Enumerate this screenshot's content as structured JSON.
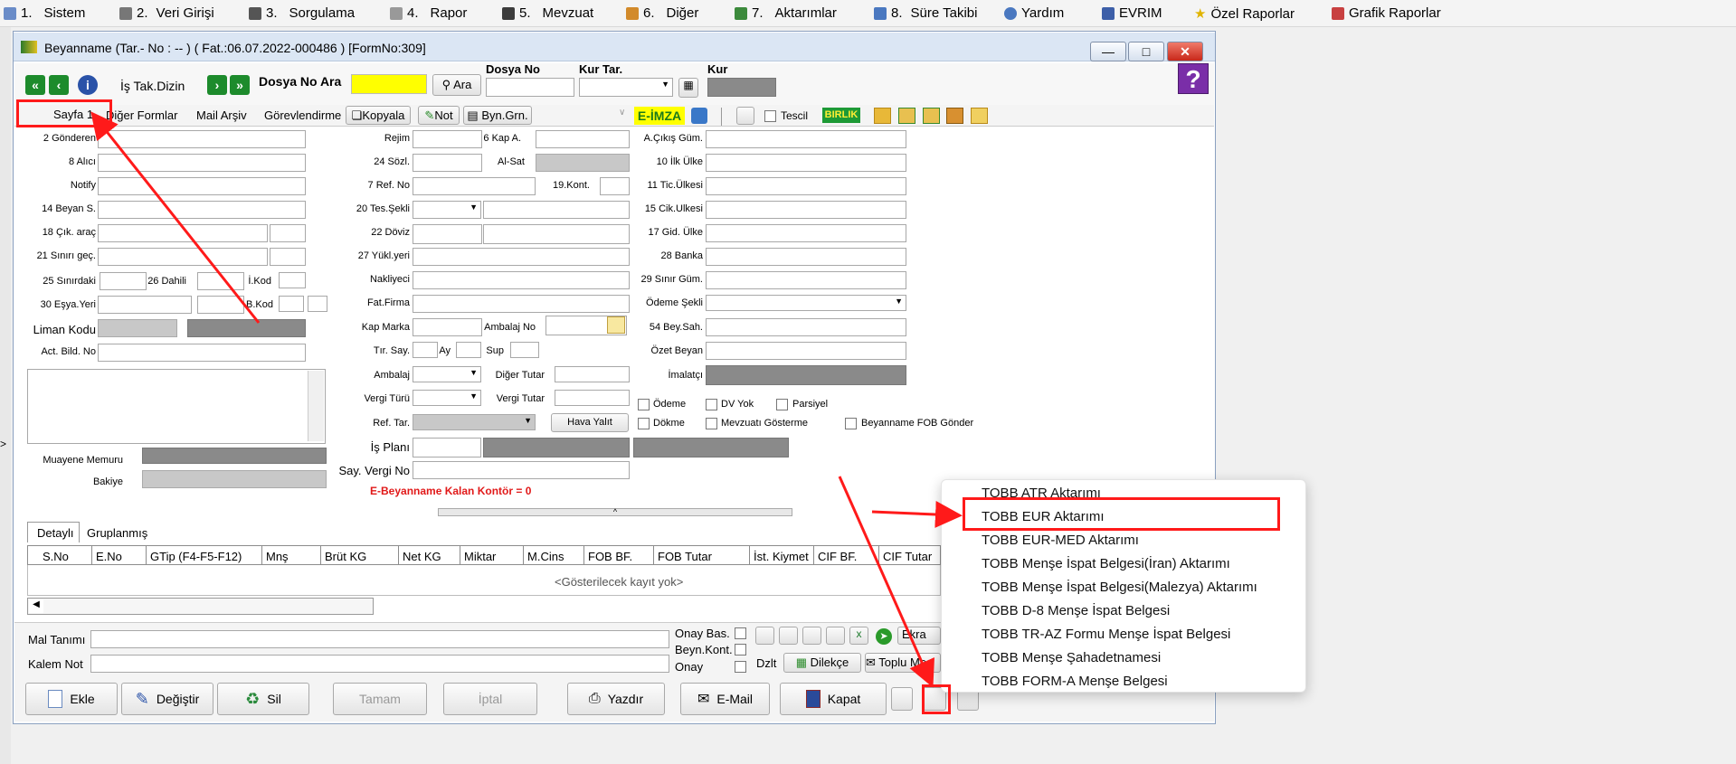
{
  "menu": [
    {
      "num": "1.",
      "label": "Sistem"
    },
    {
      "num": "2.",
      "label": "Veri Girişi"
    },
    {
      "num": "3.",
      "label": "Sorgulama"
    },
    {
      "num": "4.",
      "label": "Rapor"
    },
    {
      "num": "5.",
      "label": "Mevzuat"
    },
    {
      "num": "6.",
      "label": "Diğer"
    },
    {
      "num": "7.",
      "label": "Aktarımlar"
    },
    {
      "num": "8.",
      "label": "Süre Takibi"
    },
    {
      "num": "",
      "label": "Yardım"
    },
    {
      "num": "",
      "label": "EVRIM"
    },
    {
      "num": "",
      "label": "Özel Raporlar"
    },
    {
      "num": "",
      "label": "Grafik Raporlar"
    }
  ],
  "window": {
    "title": "Beyanname (Tar.- No : -- ) ( Fat.:06.07.2022-000486 ) [FormNo:309]"
  },
  "toolbar": {
    "is_tak_dizin": "İş Tak.Dizin",
    "dosya_no_ara": "Dosya No Ara",
    "ara": "Ara",
    "dosya_no": "Dosya No",
    "kur_tar": "Kur Tar.",
    "kur": "Kur",
    "help": "?"
  },
  "tabs": {
    "sayfa1": "Sayfa 1",
    "diger_formlar": "Diğer Formlar",
    "mail_arsiv": "Mail Arşiv",
    "gorevlendirme": "Görevlendirme",
    "kopyala": "Kopyala",
    "not": "Not",
    "byn_grn": "Byn.Grn.",
    "e_imza": "E-İMZA",
    "tescil": "Tescil",
    "birlik": "BIRLIK"
  },
  "left_fields": [
    "2 Gönderen",
    "8 Alıcı",
    "Notify",
    "14 Beyan S.",
    "18 Çık. araç",
    "21 Sınırı geç.",
    "25 Sınırdaki",
    "26 Dahili",
    "İ.Kod",
    "30 Eşya.Yeri",
    "B.Kod",
    "Liman Kodu",
    "Act. Bild. No",
    "Muayene Memuru",
    "Bakiye"
  ],
  "middle_fields": [
    "Rejim",
    "6 Kap A.",
    "24 Sözl.",
    "Al-Sat",
    "7 Ref. No",
    "19.Kont.",
    "20 Tes.Şekli",
    "22 Döviz",
    "27 Yükl.yeri",
    "Nakliyeci",
    "Fat.Firma",
    "Kap Marka",
    "Ambalaj No",
    "Tır. Say.",
    "Ay",
    "Sup",
    "Ambalaj",
    "Diğer Tutar",
    "Vergi Türü",
    "Vergi Tutar",
    "Ref. Tar.",
    "Hava Yalıt",
    "İş Planı",
    "Say. Vergi No"
  ],
  "kontor": "E-Beyanname Kalan Kontör = 0",
  "right_fields": [
    "A.Çıkış Güm.",
    "10 İlk Ülke",
    "11 Tic.Ülkesi",
    "15 Cik.Ulkesi",
    "17 Gid. Ülke",
    "28 Banka",
    "29 Sınır Güm.",
    "Ödeme Şekli",
    "54 Bey.Sah.",
    "Özet Beyan",
    "İmalatçı"
  ],
  "checkboxes": [
    "Ödeme",
    "DV Yok",
    "Parsiyel",
    "Dökme",
    "Mevzuatı Gösterme",
    "Beyanname FOB Gönder"
  ],
  "grid": {
    "tabs": [
      "Detaylı",
      "Gruplanmış"
    ],
    "columns": [
      "S.No",
      "E.No",
      "GTip (F4-F5-F12)",
      "Mnş",
      "Brüt KG",
      "Net KG",
      "Miktar",
      "M.Cins",
      "FOB BF.",
      "FOB Tutar",
      "İst. Kiymet",
      "CIF BF.",
      "CIF Tutar"
    ],
    "empty": "<Gösterilecek kayıt yok>"
  },
  "bottom": {
    "mal_tanimi": "Mal Tanımı",
    "kalem_not": "Kalem Not",
    "onay_bas": "Onay Bas.",
    "beyn_kont": "Beyn.Kont.",
    "onay": "Onay",
    "dzlt": "Dzlt",
    "dilekce": "Dilekçe",
    "toplu": "Toplu Me",
    "ekra": "Ekra"
  },
  "actions": [
    "Ekle",
    "Değiştir",
    "Sil",
    "Tamam",
    "İptal",
    "Yazdır",
    "E-Mail",
    "Kapat"
  ],
  "popup": [
    "TOBB ATR Aktarımı",
    "TOBB EUR Aktarımı",
    "TOBB EUR-MED Aktarımı",
    "TOBB Menşe İspat Belgesi(İran) Aktarımı",
    "TOBB Menşe İspat Belgesi(Malezya) Aktarımı",
    "TOBB D-8 Menşe İspat Belgesi",
    "TOBB TR-AZ Formu Menşe İspat Belgesi",
    "TOBB Menşe Şahadetnamesi",
    "TOBB FORM-A Menşe Belgesi"
  ],
  "colors": {
    "highlight": "#ff1a1a",
    "e_imza_bg": "#ffff00",
    "birlik_bg": "#1e9a36",
    "kontor": "#e11919"
  }
}
